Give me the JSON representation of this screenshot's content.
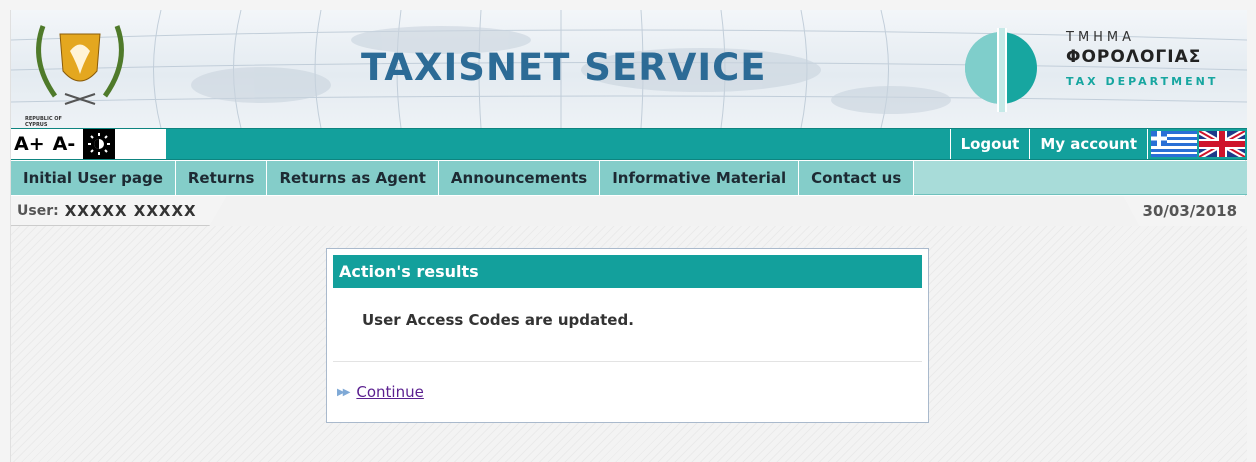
{
  "banner": {
    "title": "TAXISNET SERVICE",
    "coat_caption": "REPUBLIC OF CYPRUS",
    "dept_greek_line1": "ΤΜΗΜΑ",
    "dept_greek_line2": "ΦΟΡΟΛΟΓΙΑΣ",
    "dept_english": "TAX DEPARTMENT"
  },
  "topbar": {
    "font_increase": "A+",
    "font_decrease": "A-",
    "contrast_icon": "sun-contrast-icon",
    "logout": "Logout",
    "my_account": "My account",
    "flags": [
      "greek-flag-icon",
      "uk-flag-icon"
    ]
  },
  "nav": {
    "items": [
      "Initial User page",
      "Returns",
      "Returns as Agent",
      "Announcements",
      "Informative Material",
      "Contact us"
    ]
  },
  "userbar": {
    "label": "User:",
    "name": "XXXXX XXXXX",
    "date": "30/03/2018"
  },
  "panel": {
    "title": "Action's results",
    "message": "User Access Codes are updated.",
    "continue_label": "Continue"
  },
  "colors": {
    "teal": "#13a09c",
    "nav": "#84cdc9",
    "title_blue": "#2c6b96",
    "link_purple": "#5a1f8f"
  }
}
